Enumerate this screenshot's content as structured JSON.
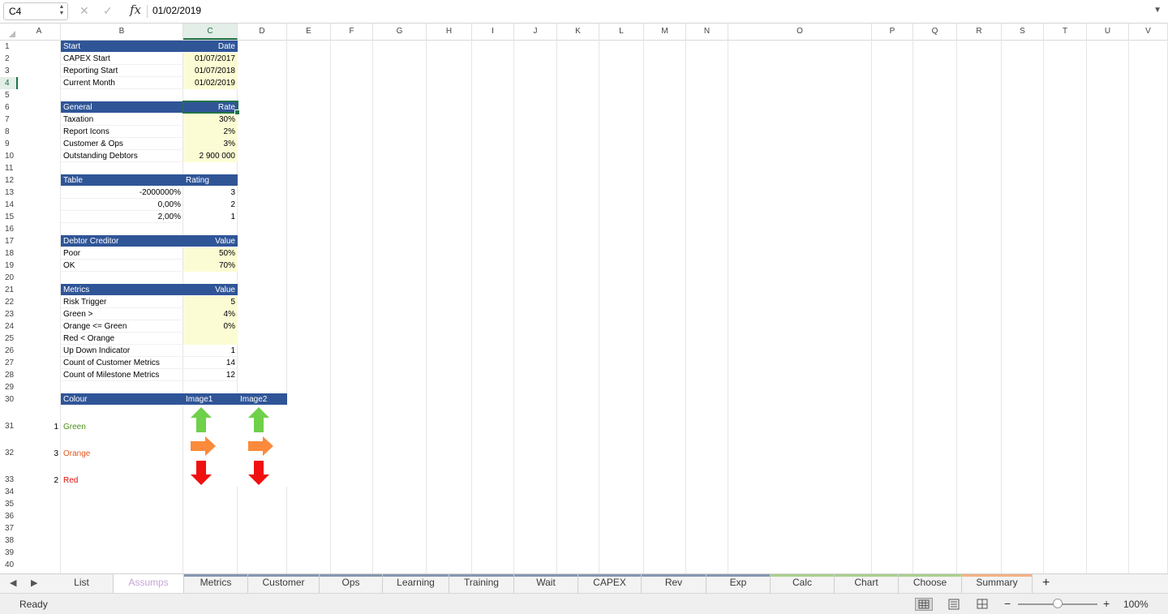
{
  "formula_bar": {
    "cell_ref": "C4",
    "formula": "01/02/2019",
    "fx_label": "fx",
    "cancel_icon": "close-icon",
    "enter_icon": "check-icon"
  },
  "grid": {
    "columns": [
      "A",
      "B",
      "C",
      "D",
      "E",
      "F",
      "G",
      "H",
      "I",
      "J",
      "K",
      "L",
      "M",
      "N",
      "O",
      "P",
      "Q",
      "R",
      "S",
      "T",
      "U",
      "V"
    ],
    "selected_column": "C",
    "rows": [
      "1",
      "2",
      "3",
      "4",
      "5",
      "6",
      "7",
      "8",
      "9",
      "10",
      "11",
      "12",
      "13",
      "14",
      "15",
      "16",
      "17",
      "18",
      "19",
      "20",
      "21",
      "22",
      "23",
      "24",
      "25",
      "26",
      "27",
      "28",
      "29",
      "30",
      "31",
      "32",
      "33",
      "34",
      "35",
      "36",
      "37",
      "38",
      "39",
      "40"
    ],
    "selected_row": "4"
  },
  "sheet": {
    "start": {
      "header": "Start",
      "value_header": "Date",
      "rows": [
        {
          "label": "CAPEX Start",
          "value": "01/07/2017"
        },
        {
          "label": "Reporting Start",
          "value": "01/07/2018"
        },
        {
          "label": "Current Month",
          "value": "01/02/2019"
        }
      ]
    },
    "general": {
      "header": "General",
      "value_header": "Rate",
      "rows": [
        {
          "label": "Taxation",
          "value": "30%"
        },
        {
          "label": "Report Icons",
          "value": "2%"
        },
        {
          "label": "Customer & Ops",
          "value": "3%"
        },
        {
          "label": "Outstanding Debtors",
          "value": "2 900 000"
        }
      ]
    },
    "table": {
      "header": "Table",
      "value_header": "Rating",
      "rows": [
        {
          "label": "-2000000%",
          "value": "3"
        },
        {
          "label": "0,00%",
          "value": "2"
        },
        {
          "label": "2,00%",
          "value": "1"
        }
      ]
    },
    "debtor": {
      "header": "Debtor Creditor",
      "value_header": "Value",
      "rows": [
        {
          "label": "Poor",
          "value": "50%"
        },
        {
          "label": "OK",
          "value": "70%"
        }
      ]
    },
    "metrics": {
      "header": "Metrics",
      "value_header": "Value",
      "rows": [
        {
          "label": "Risk Trigger",
          "value": "5"
        },
        {
          "label": "Green >",
          "value": "4%"
        },
        {
          "label": "Orange <= Green",
          "value": "0%"
        },
        {
          "label": "Red < Orange",
          "value": ""
        },
        {
          "label": "Up Down Indicator",
          "value": "1"
        },
        {
          "label": "Count of Customer Metrics",
          "value": "14"
        },
        {
          "label": "Count of Milestone Metrics",
          "value": "12"
        }
      ]
    },
    "colour": {
      "header": "Colour",
      "image1_header": "Image1",
      "image2_header": "Image2",
      "rows": [
        {
          "num": "1",
          "label": "Green",
          "color": "#4e8f1c",
          "arrow": "up-arrow-icon",
          "arrow_color": "#6fd04a"
        },
        {
          "num": "3",
          "label": "Orange",
          "color": "#e2561c",
          "arrow": "right-arrow-icon",
          "arrow_color": "#fb8a3c"
        },
        {
          "num": "2",
          "label": "Red",
          "color": "#e01010",
          "arrow": "down-arrow-icon",
          "arrow_color": "#f01010"
        }
      ]
    }
  },
  "tabs": [
    {
      "label": "List",
      "active": false,
      "strip": ""
    },
    {
      "label": "Assumps",
      "active": true,
      "strip": ""
    },
    {
      "label": "Metrics",
      "active": false,
      "strip": "#8497b0"
    },
    {
      "label": "Customer",
      "active": false,
      "strip": "#8497b0"
    },
    {
      "label": "Ops",
      "active": false,
      "strip": "#8497b0"
    },
    {
      "label": "Learning",
      "active": false,
      "strip": "#8497b0"
    },
    {
      "label": "Training",
      "active": false,
      "strip": "#8497b0"
    },
    {
      "label": "Wait",
      "active": false,
      "strip": "#8497b0"
    },
    {
      "label": "CAPEX",
      "active": false,
      "strip": "#8497b0"
    },
    {
      "label": "Rev",
      "active": false,
      "strip": "#8497b0"
    },
    {
      "label": "Exp",
      "active": false,
      "strip": "#8497b0"
    },
    {
      "label": "Calc",
      "active": false,
      "strip": "#a9d08e"
    },
    {
      "label": "Chart",
      "active": false,
      "strip": "#a9d08e"
    },
    {
      "label": "Choose",
      "active": false,
      "strip": "#a9d08e"
    },
    {
      "label": "Summary",
      "active": false,
      "strip": "#f4b084"
    }
  ],
  "status": {
    "text": "Ready",
    "zoom": "100%"
  },
  "colors": {
    "header_fill": "#2f5597",
    "input_fill": "#fcfcd4",
    "selection": "#217346"
  }
}
